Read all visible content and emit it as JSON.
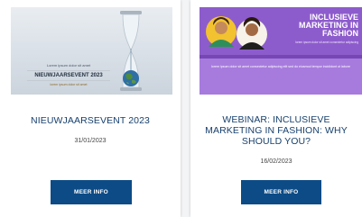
{
  "cards": [
    {
      "title": "NIEUWJAARSEVENT 2023",
      "date": "31/01/2023",
      "button": "MEER INFO",
      "image": {
        "small_text": "Lorem ipsum dolor sit amet",
        "headline": "NIEUWJAARSEVENT 2023",
        "sub_text": "lorem ipsum dolor sit amet"
      }
    },
    {
      "title": "WEBINAR: INCLUSIEVE MARKETING IN FASHION: WHY SHOULD YOU?",
      "date": "16/02/2023",
      "button": "MEER INFO",
      "image": {
        "headline_1": "INCLUSIEVE",
        "headline_2": "MARKETING IN",
        "headline_3": "FASHION",
        "sub_text": "lorem ipsum dolor sit amet consectetur adipiscing",
        "caption": "lorem ipsum dolor sit amet consectetur adipiscing elit sed do eiusmod tempor incididunt ut labore"
      }
    }
  ],
  "colors": {
    "title": "#17406d",
    "button": "#0c4b86",
    "purple": "#8d5ccc"
  }
}
